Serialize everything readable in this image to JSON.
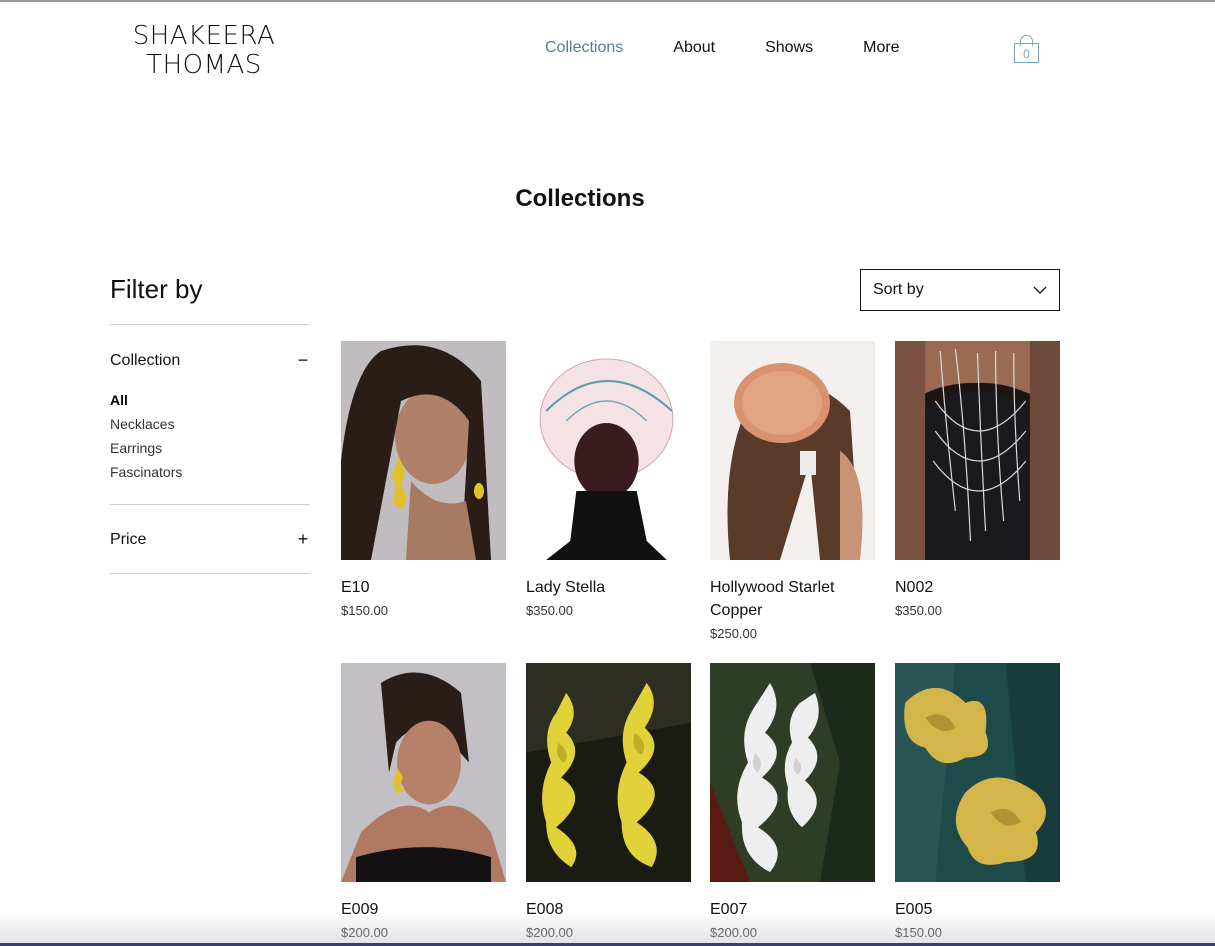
{
  "brand": {
    "line1": "SHAKEERA",
    "line2": "THOMAS"
  },
  "nav": {
    "items": [
      {
        "label": "Collections",
        "active": true
      },
      {
        "label": "About"
      },
      {
        "label": "Shows"
      },
      {
        "label": "More"
      }
    ],
    "cart_count": "0",
    "accent_color": "#5a7a94"
  },
  "page": {
    "title": "Collections"
  },
  "filter": {
    "title": "Filter by",
    "collection": {
      "label": "Collection",
      "toggle": "−",
      "options": [
        "All",
        "Necklaces",
        "Earrings",
        "Fascinators"
      ],
      "selected": "All"
    },
    "price": {
      "label": "Price",
      "toggle": "+"
    }
  },
  "sort": {
    "label": "Sort by"
  },
  "products": [
    {
      "name": "E10",
      "price": "$150.00"
    },
    {
      "name": "Lady Stella",
      "price": "$350.00"
    },
    {
      "name": "Hollywood Starlet Copper",
      "price": "$250.00"
    },
    {
      "name": "N002",
      "price": "$350.00"
    },
    {
      "name": "E009",
      "price": "$200.00"
    },
    {
      "name": "E008",
      "price": "$200.00"
    },
    {
      "name": "E007",
      "price": "$200.00"
    },
    {
      "name": "E005",
      "price": "$150.00"
    }
  ]
}
